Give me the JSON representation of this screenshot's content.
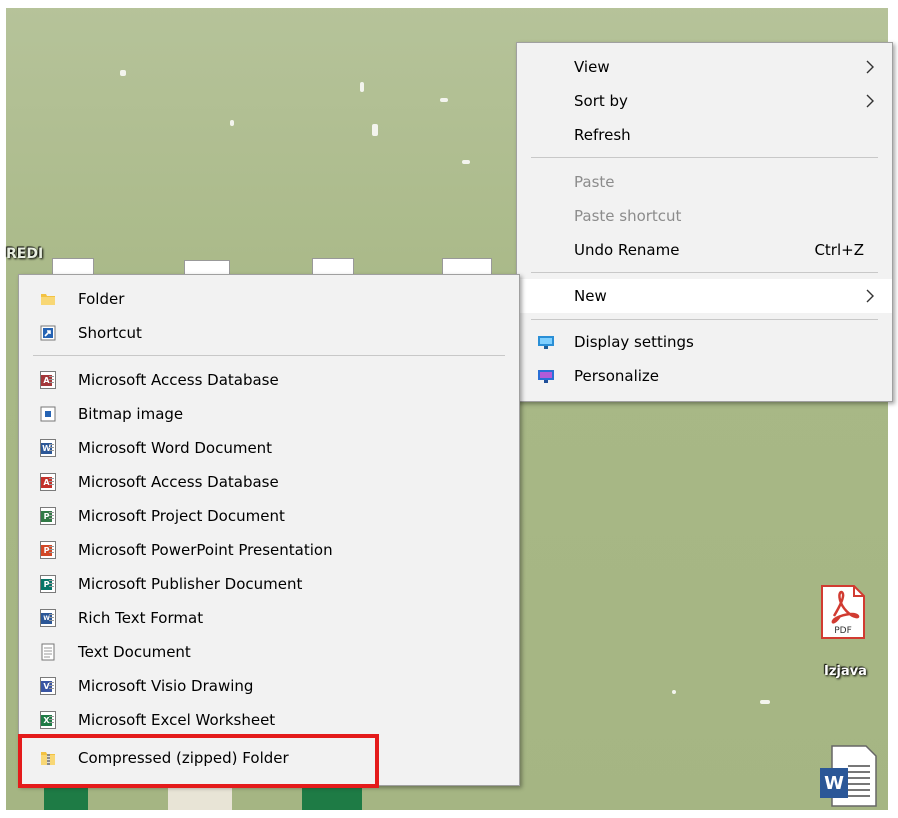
{
  "desktop_menu": {
    "items": [
      {
        "label": "View",
        "submenu": true
      },
      {
        "label": "Sort by",
        "submenu": true
      },
      {
        "label": "Refresh"
      },
      {
        "label": "Paste",
        "disabled": true
      },
      {
        "label": "Paste shortcut",
        "disabled": true
      },
      {
        "label": "Undo Rename",
        "accelerator": "Ctrl+Z"
      },
      {
        "label": "New",
        "submenu": true,
        "highlighted": true
      },
      {
        "label": "Display settings",
        "icon": "display-settings-icon"
      },
      {
        "label": "Personalize",
        "icon": "personalize-icon"
      }
    ]
  },
  "new_submenu": {
    "items": [
      {
        "label": "Folder",
        "icon": "folder-icon"
      },
      {
        "label": "Shortcut",
        "icon": "shortcut-icon"
      },
      {
        "label": "Microsoft Access Database",
        "icon": "access-database-icon"
      },
      {
        "label": "Bitmap image",
        "icon": "bitmap-image-icon"
      },
      {
        "label": "Microsoft Word Document",
        "icon": "word-document-icon"
      },
      {
        "label": "Microsoft Access Database",
        "icon": "access-database-icon"
      },
      {
        "label": "Microsoft Project Document",
        "icon": "project-document-icon"
      },
      {
        "label": "Microsoft PowerPoint Presentation",
        "icon": "powerpoint-presentation-icon"
      },
      {
        "label": "Microsoft Publisher Document",
        "icon": "publisher-document-icon"
      },
      {
        "label": "Rich Text Format",
        "icon": "rich-text-format-icon"
      },
      {
        "label": "Text Document",
        "icon": "text-document-icon"
      },
      {
        "label": "Microsoft Visio Drawing",
        "icon": "visio-drawing-icon"
      },
      {
        "label": "Microsoft Excel Worksheet",
        "icon": "excel-worksheet-icon"
      },
      {
        "label": "Compressed (zipped) Folder",
        "icon": "zipped-folder-icon"
      }
    ]
  },
  "desktop_icons": {
    "pdf_label": "Izjava",
    "pdf_badge": "PDF",
    "word_badge": "W",
    "partial_label": "REDI"
  },
  "colors": {
    "highlight_box": "#e41b1b",
    "menu_bg": "#f2f2f2",
    "desktop_bg": "#a9b988"
  }
}
